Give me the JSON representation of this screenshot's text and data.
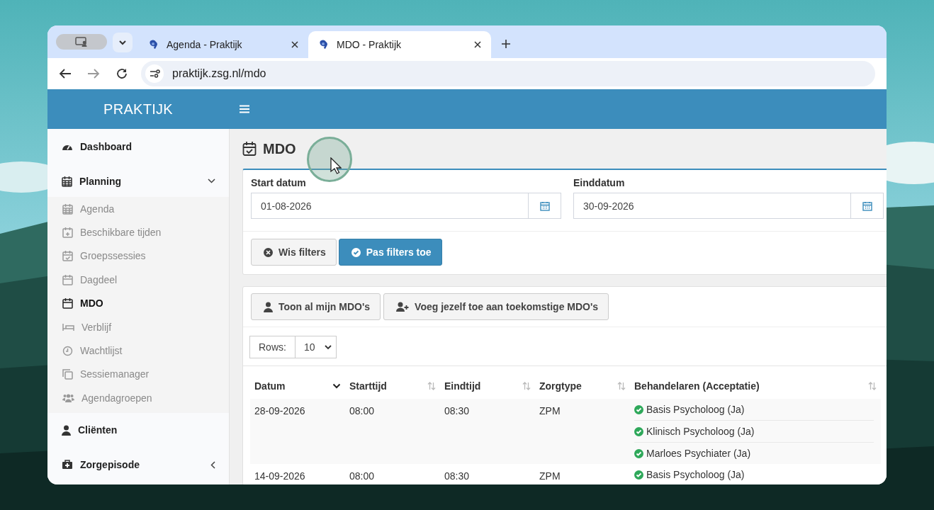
{
  "browser": {
    "tabs": [
      {
        "title": "Agenda - Praktijk",
        "selected": false
      },
      {
        "title": "MDO - Praktijk",
        "selected": true
      }
    ],
    "url": "praktijk.zsg.nl/mdo"
  },
  "app": {
    "brand": "PRAKTIJK"
  },
  "sidebar": {
    "items": [
      {
        "label": "Dashboard"
      },
      {
        "label": "Planning",
        "expanded": true,
        "children": [
          {
            "label": "Agenda",
            "selected": false
          },
          {
            "label": "Beschikbare tijden",
            "selected": false
          },
          {
            "label": "Groepssessies",
            "selected": false
          },
          {
            "label": "Dagdeel",
            "selected": false
          },
          {
            "label": "MDO",
            "selected": true
          },
          {
            "label": "Verblijf",
            "selected": false
          },
          {
            "label": "Wachtlijst",
            "selected": false
          },
          {
            "label": "Sessiemanager",
            "selected": false
          },
          {
            "label": "Agendagroepen",
            "selected": false
          }
        ]
      },
      {
        "label": "Cliënten"
      },
      {
        "label": "Zorgepisode",
        "expanded": false
      }
    ]
  },
  "page": {
    "title": "MDO"
  },
  "filters": {
    "fields": [
      {
        "label": "Start datum",
        "value": "01-08-2026"
      },
      {
        "label": "Einddatum",
        "value": "30-09-2026"
      }
    ],
    "buttons": [
      {
        "label": "Wis filters",
        "kind": "default"
      },
      {
        "label": "Pas filters toe",
        "kind": "primary"
      }
    ]
  },
  "actions": [
    {
      "label": "Toon al mijn MDO's"
    },
    {
      "label": "Voeg jezelf toe aan toekomstige MDO's"
    }
  ],
  "rows_select": {
    "label": "Rows:",
    "value": "10"
  },
  "table": {
    "columns": [
      {
        "label": "Datum",
        "sorted": true
      },
      {
        "label": "Starttijd",
        "sorted": false
      },
      {
        "label": "Eindtijd",
        "sorted": false
      },
      {
        "label": "Zorgtype",
        "sorted": false
      },
      {
        "label": "Behandelaren (Acceptatie)",
        "sorted": false
      }
    ],
    "rows": [
      {
        "cells": [
          "28-09-2026",
          "08:00",
          "08:30",
          "ZPM"
        ],
        "behandelaren": [
          {
            "name": "Basis Psycholoog (Ja)",
            "accepted": true
          },
          {
            "name": "Klinisch Psycholoog (Ja)",
            "accepted": true
          },
          {
            "name": "Marloes Psychiater (Ja)",
            "accepted": true
          }
        ]
      },
      {
        "cells": [
          "14-09-2026",
          "08:00",
          "08:30",
          "ZPM"
        ],
        "behandelaren": [
          {
            "name": "Basis Psycholoog (Ja)",
            "accepted": true
          }
        ]
      }
    ]
  }
}
